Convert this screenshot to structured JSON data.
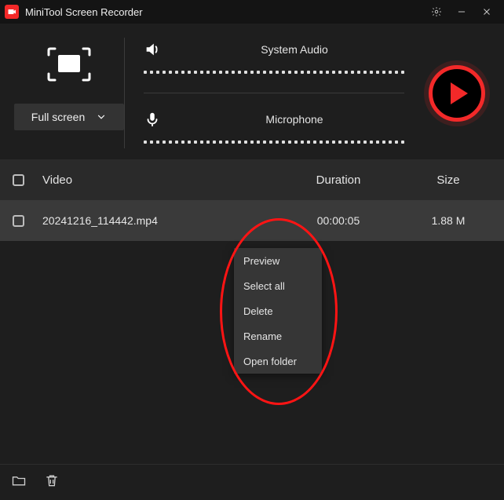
{
  "titlebar": {
    "title": "MiniTool Screen Recorder"
  },
  "capture": {
    "mode_label": "Full screen"
  },
  "audio": {
    "system_label": "System Audio",
    "mic_label": "Microphone"
  },
  "table": {
    "headers": {
      "name": "Video",
      "duration": "Duration",
      "size": "Size"
    },
    "rows": [
      {
        "name": "20241216_114442.mp4",
        "duration": "00:00:05",
        "size": "1.88 M"
      }
    ]
  },
  "context_menu": {
    "items": [
      {
        "label": "Preview"
      },
      {
        "label": "Select all"
      },
      {
        "label": "Delete"
      },
      {
        "label": "Rename"
      },
      {
        "label": "Open folder"
      }
    ]
  }
}
